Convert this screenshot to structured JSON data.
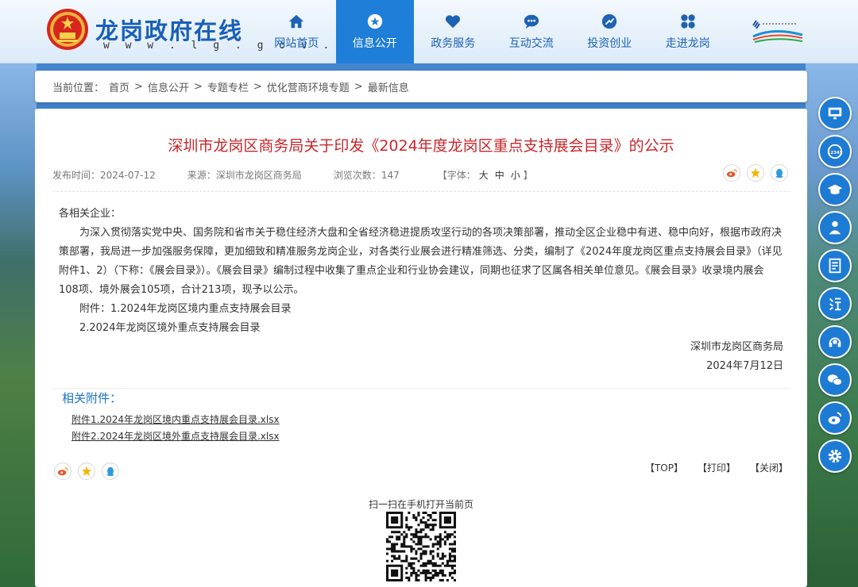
{
  "site": {
    "title": "龙岗政府在线",
    "url": "w w w . l g . g o v . c n"
  },
  "nav": [
    {
      "label": "网站首页",
      "icon": "home-icon"
    },
    {
      "label": "信息公开",
      "icon": "info-icon",
      "active": true
    },
    {
      "label": "政务服务",
      "icon": "heart-icon"
    },
    {
      "label": "互动交流",
      "icon": "chat-icon"
    },
    {
      "label": "投资创业",
      "icon": "invest-icon"
    },
    {
      "label": "走进龙岗",
      "icon": "grid-icon"
    }
  ],
  "breadcrumb": {
    "prefix": "当前位置：",
    "sep": ">",
    "items": [
      "首页",
      "信息公开",
      "专题专栏",
      "优化营商环境专题",
      "最新信息"
    ]
  },
  "article": {
    "title": "深圳市龙岗区商务局关于印发《2024年度龙岗区重点支持展会目录》的公示",
    "publish_label": "发布时间：",
    "publish_date": "2024-07-12",
    "source_label": "来源：",
    "source": "深圳市龙岗区商务局",
    "views_label": "浏览次数：",
    "views": "147",
    "font_label_open": "【字体：",
    "font_large": "大",
    "font_medium": "中",
    "font_small": "小",
    "font_label_close": "】",
    "salutation": "各相关企业：",
    "paragraph": "为深入贯彻落实党中央、国务院和省市关于稳住经济大盘和全省经济稳进提质攻坚行动的各项决策部署，推动全区企业稳中有进、稳中向好，根据市政府决策部署，我局进一步加强服务保障，更加细致和精准服务龙岗企业，对各类行业展会进行精准筛选、分类，编制了《2024年度龙岗区重点支持展会目录》（详见附件1、2）（下称：《展会目录》）。《展会目录》编制过程中收集了重点企业和行业协会建议，同期也征求了区属各相关单位意见。《展会目录》收录境内展会108项、境外展会105项，合计213项，现予以公示。",
    "attach_line1": "附件：1.2024年龙岗区境内重点支持展会目录",
    "attach_line2": "2.2024年龙岗区境外重点支持展会目录",
    "signature": "深圳市龙岗区商务局",
    "sign_date": "2024年7月12日"
  },
  "attachments": {
    "heading": "相关附件：",
    "files": [
      "附件1.2024年龙岗区境内重点支持展会目录.xlsx",
      "附件2.2024年龙岗区境外重点支持展会目录.xlsx"
    ]
  },
  "tools": {
    "top": "【TOP】",
    "print": "【打印】",
    "close": "【关闭】"
  },
  "qr": {
    "caption": "扫一扫在手机打开当前页"
  },
  "sidebar_extra": {
    "hotline": "12345"
  },
  "colors": {
    "brand": "#1f7fd8",
    "title_red": "#c8262a",
    "link_blue": "#1a73c8"
  }
}
